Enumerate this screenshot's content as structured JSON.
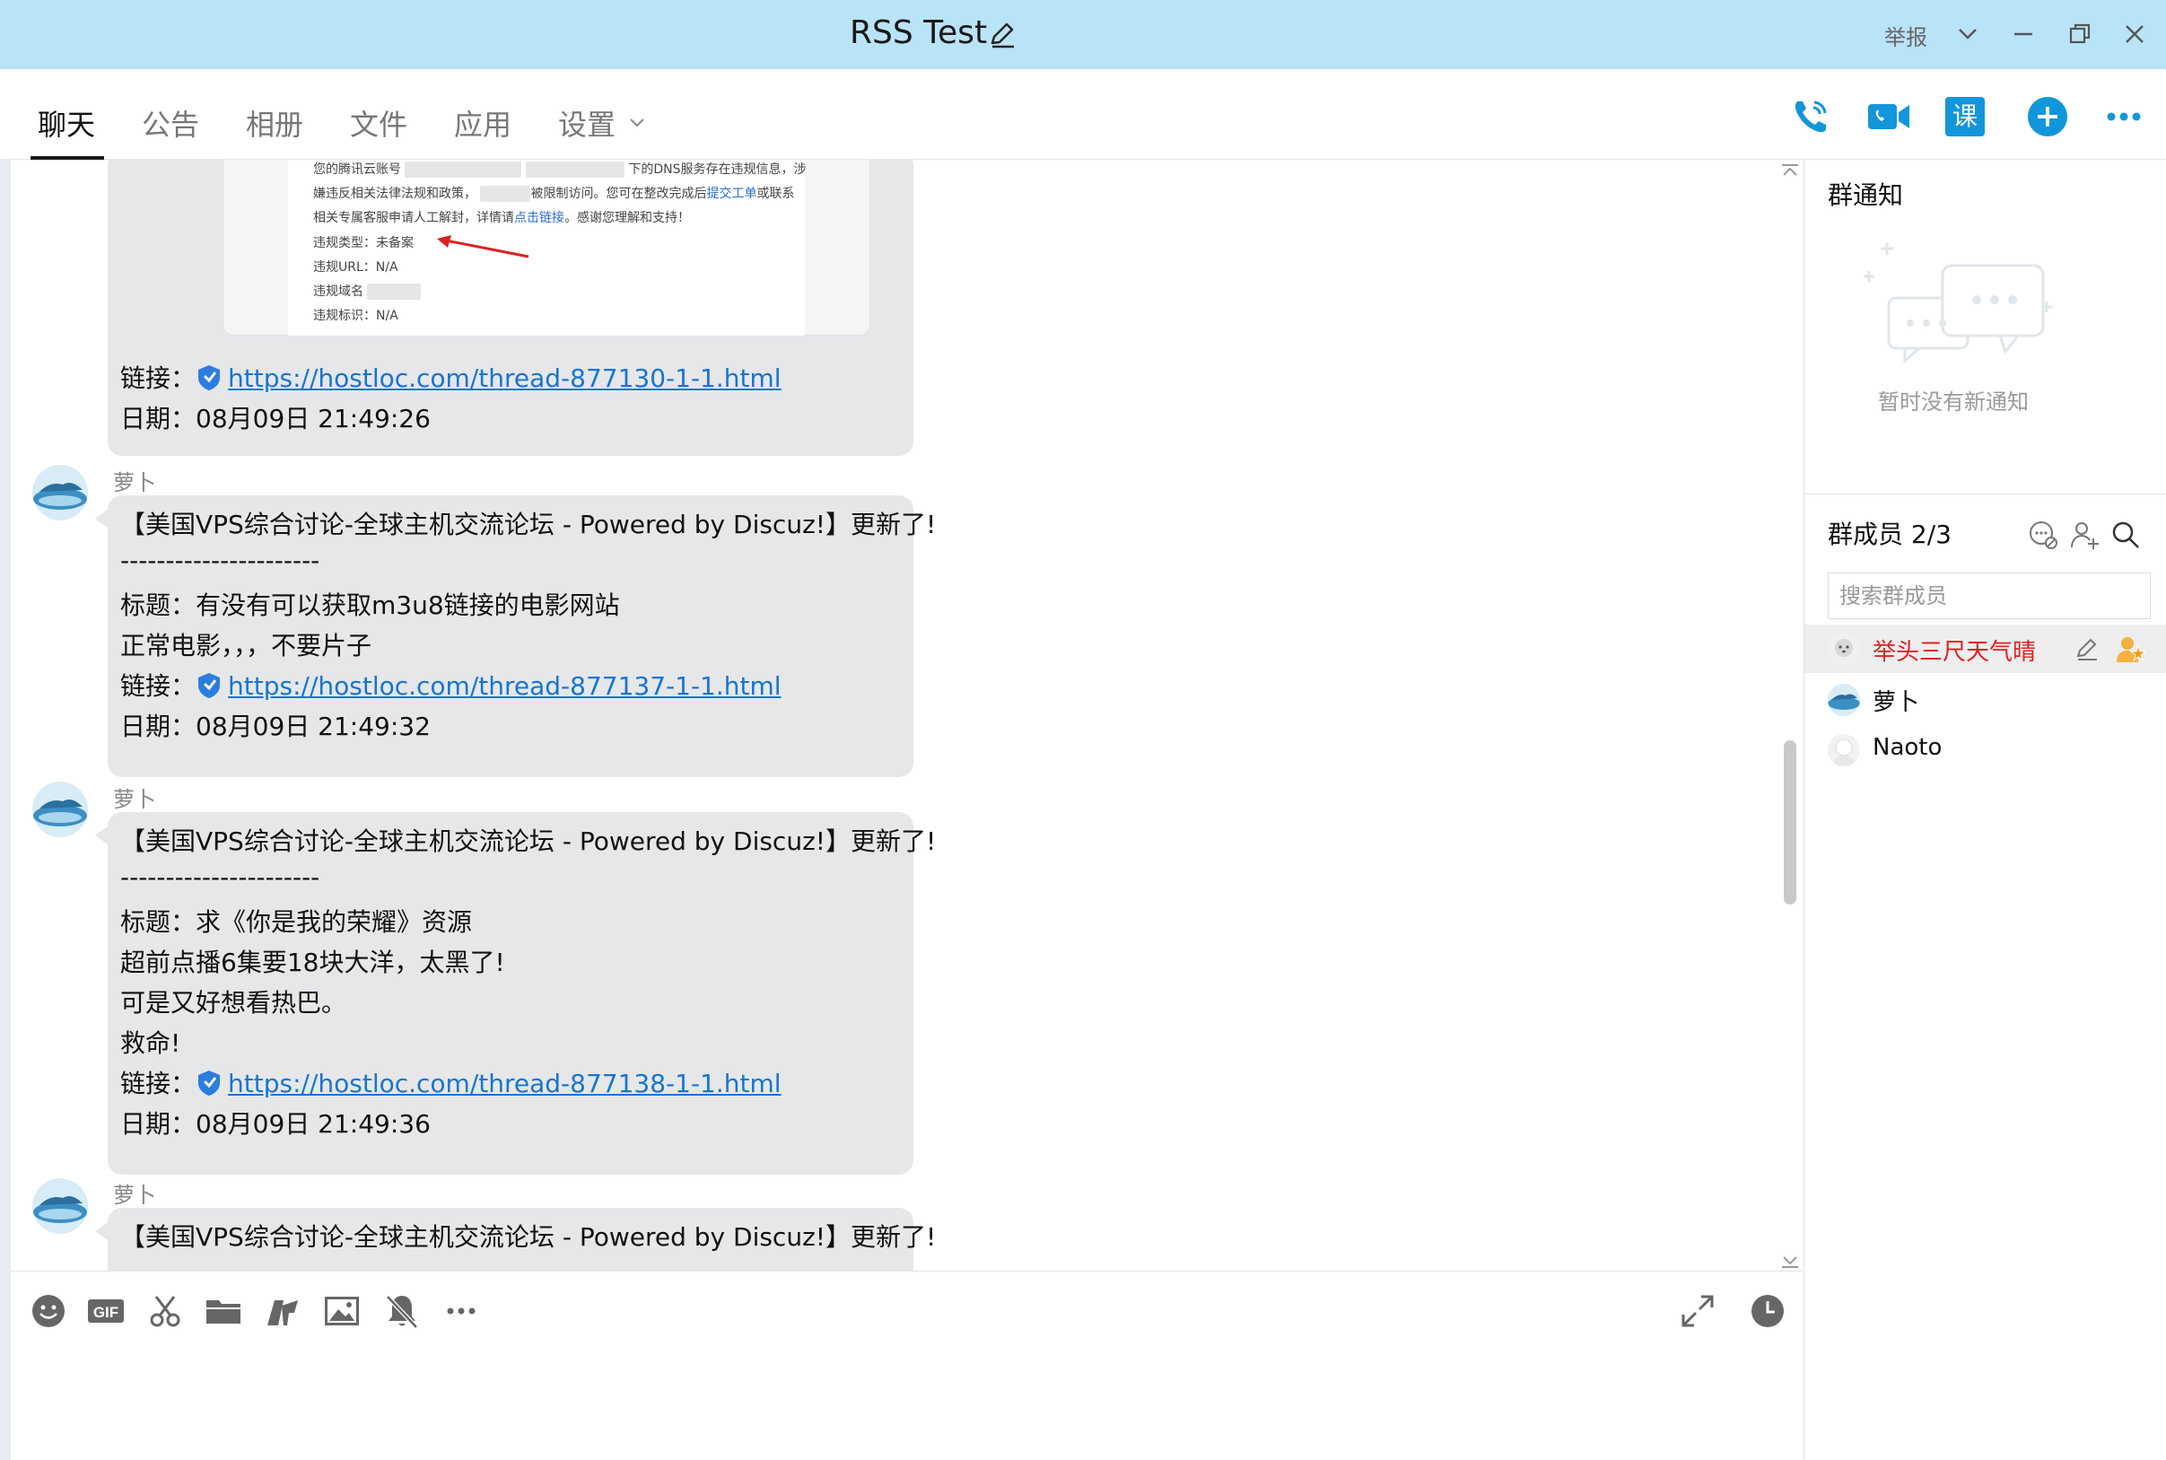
{
  "window": {
    "title": "RSS Test",
    "report_label": "举报"
  },
  "tabs": [
    {
      "label": "聊天",
      "active": true
    },
    {
      "label": "公告",
      "active": false
    },
    {
      "label": "相册",
      "active": false
    },
    {
      "label": "文件",
      "active": false
    },
    {
      "label": "应用",
      "active": false
    },
    {
      "label": "设置",
      "active": false
    }
  ],
  "toolbar_icons": [
    "phone-call-icon",
    "video-call-icon",
    "course-icon",
    "add-icon",
    "more-icon"
  ],
  "toolbar_course_label": "课",
  "embedded_screenshot": {
    "lines": [
      "您的腾讯云账号",
      "下的DNS服务存在违规信息，涉",
      "嫌违反相关法律法规和政策，",
      "被限制访问。您可在整改完成后",
      "提交工单",
      "或联系",
      "相关专属客服申请人工解封，详情请",
      "点击链接",
      "。感谢您理解和支持！",
      "违规类型：未备案",
      "违规URL：N/A",
      "违规域名",
      "违规标识：N/A"
    ]
  },
  "messages": [
    {
      "link_label": "链接：",
      "link": "https://hostloc.com/thread-877130-1-1.html",
      "date_line": "日期：08月09日 21:49:26"
    },
    {
      "sender": "萝卜",
      "header": "【美国VPS综合讨论-全球主机交流论坛 -  Powered by Discuz!】更新了!",
      "separator": "----------------------",
      "title": "标题：有没有可以获取m3u8链接的电影网站",
      "body": [
        "正常电影，，，不要片子"
      ],
      "link_label": "链接：",
      "link": "https://hostloc.com/thread-877137-1-1.html",
      "date_line": "日期：08月09日 21:49:32"
    },
    {
      "sender": "萝卜",
      "header": "【美国VPS综合讨论-全球主机交流论坛 -  Powered by Discuz!】更新了!",
      "separator": "----------------------",
      "title": "标题：求《你是我的荣耀》资源",
      "body": [
        "超前点播6集要18块大洋，太黑了!",
        "可是又好想看热巴。",
        "救命!"
      ],
      "link_label": "链接：",
      "link": "https://hostloc.com/thread-877138-1-1.html",
      "date_line": "日期：08月09日 21:49:36"
    },
    {
      "sender": "萝卜",
      "header": "【美国VPS综合讨论-全球主机交流论坛 -  Powered by Discuz!】更新了!"
    }
  ],
  "input_toolbar_icons": [
    "emoji-icon",
    "gif-icon",
    "scissors-icon",
    "folder-icon",
    "font-icon",
    "image-icon",
    "mute-bell-icon",
    "more-icon",
    "expand-icon",
    "history-clock-icon"
  ],
  "right_panel": {
    "notice_title": "群通知",
    "notice_empty": "暂时没有新通知",
    "members_title": "群成员 2/3",
    "search_placeholder": "搜索群成员",
    "members": [
      {
        "name": "举头三尺天气晴",
        "owner": true
      },
      {
        "name": "萝卜",
        "owner": false
      },
      {
        "name": "Naoto",
        "owner": false
      }
    ]
  },
  "colors": {
    "titlebar": "#b9e3f7",
    "accent": "#1296db",
    "link": "#1675d2",
    "bubble": "#e6e7e9",
    "owner_name": "#e02020"
  }
}
